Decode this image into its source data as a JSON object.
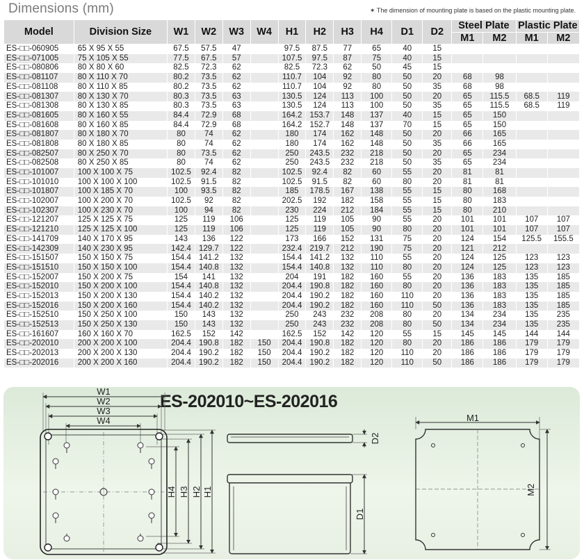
{
  "page": {
    "title": "Dimensions (mm)",
    "note": "✶ The dimension of mounting plate is based on the plastic mounting plate."
  },
  "table": {
    "headers": {
      "model": "Model",
      "division_size": "Division Size",
      "w1": "W1",
      "w2": "W2",
      "w3": "W3",
      "w4": "W4",
      "h1": "H1",
      "h2": "H2",
      "h3": "H3",
      "h4": "H4",
      "d1": "D1",
      "d2": "D2",
      "steel_plate": "Steel Plate",
      "plastic_plate": "Plastic Plate",
      "steel_m1": "M1",
      "steel_m2": "M2",
      "plastic_m1": "M1",
      "plastic_m2": "M2"
    },
    "rows": [
      [
        "ES-□□-060905",
        "65 X 95 X 55",
        "67.5",
        "57.5",
        "47",
        "",
        "97.5",
        "87.5",
        "77",
        "65",
        "40",
        "15",
        "",
        "",
        "",
        ""
      ],
      [
        "ES-□□-071005",
        "75 X 105 X 55",
        "77.5",
        "67.5",
        "57",
        "",
        "107.5",
        "97.5",
        "87",
        "75",
        "40",
        "15",
        "",
        "",
        "",
        ""
      ],
      [
        "ES-□□-080806",
        "80 X 80 X 60",
        "82.5",
        "72.3",
        "62",
        "",
        "82.5",
        "72.3",
        "62",
        "50",
        "45",
        "15",
        "",
        "",
        "",
        ""
      ],
      [
        "ES-□□-081107",
        "80 X 110 X 70",
        "80.2",
        "73.5",
        "62",
        "",
        "110.7",
        "104",
        "92",
        "80",
        "50",
        "20",
        "68",
        "98",
        "",
        ""
      ],
      [
        "ES-□□-081108",
        "80 X 110 X 85",
        "80.2",
        "73.5",
        "62",
        "",
        "110.7",
        "104",
        "92",
        "80",
        "50",
        "35",
        "68",
        "98",
        "",
        ""
      ],
      [
        "ES-□□-081307",
        "80 X 130 X 70",
        "80.3",
        "73.5",
        "63",
        "",
        "130.5",
        "124",
        "113",
        "100",
        "50",
        "20",
        "65",
        "115.5",
        "68.5",
        "119"
      ],
      [
        "ES-□□-081308",
        "80 X 130 X 85",
        "80.3",
        "73.5",
        "63",
        "",
        "130.5",
        "124",
        "113",
        "100",
        "50",
        "35",
        "65",
        "115.5",
        "68.5",
        "119"
      ],
      [
        "ES-□□-081605",
        "80 X 160 X 55",
        "84.4",
        "72.9",
        "68",
        "",
        "164.2",
        "153.7",
        "148",
        "137",
        "40",
        "15",
        "65",
        "150",
        "",
        ""
      ],
      [
        "ES-□□-081608",
        "80 X 160 X 85",
        "84.4",
        "72.9",
        "68",
        "",
        "164.2",
        "152.7",
        "148",
        "137",
        "70",
        "15",
        "65",
        "150",
        "",
        ""
      ],
      [
        "ES-□□-081807",
        "80 X 180 X 70",
        "80",
        "74",
        "62",
        "",
        "180",
        "174",
        "162",
        "148",
        "50",
        "20",
        "66",
        "165",
        "",
        ""
      ],
      [
        "ES-□□-081808",
        "80 X 180 X 85",
        "80",
        "74",
        "62",
        "",
        "180",
        "174",
        "162",
        "148",
        "50",
        "35",
        "66",
        "165",
        "",
        ""
      ],
      [
        "ES-□□-082507",
        "80 X 250 X 70",
        "80",
        "73.5",
        "62",
        "",
        "250",
        "243.5",
        "232",
        "218",
        "50",
        "20",
        "65",
        "234",
        "",
        ""
      ],
      [
        "ES-□□-082508",
        "80 X 250 X 85",
        "80",
        "74",
        "62",
        "",
        "250",
        "243.5",
        "232",
        "218",
        "50",
        "35",
        "65",
        "234",
        "",
        ""
      ],
      [
        "ES-□□-101007",
        "100 X 100 X 75",
        "102.5",
        "92.4",
        "82",
        "",
        "102.5",
        "92.4",
        "82",
        "60",
        "55",
        "20",
        "81",
        "81",
        "",
        ""
      ],
      [
        "ES-□□-101010",
        "100 X 100 X 100",
        "102.5",
        "91.5",
        "82",
        "",
        "102.5",
        "91.5",
        "82",
        "60",
        "80",
        "20",
        "81",
        "81",
        "",
        ""
      ],
      [
        "ES-□□-101807",
        "100 X 185 X 70",
        "100",
        "93.5",
        "82",
        "",
        "185",
        "178.5",
        "167",
        "138",
        "55",
        "15",
        "80",
        "168",
        "",
        ""
      ],
      [
        "ES-□□-102007",
        "100 X 200 X 70",
        "102.5",
        "92",
        "82",
        "",
        "202.5",
        "192",
        "182",
        "158",
        "55",
        "15",
        "80",
        "183",
        "",
        ""
      ],
      [
        "ES-□□-102307",
        "100 X 230 X 70",
        "100",
        "94",
        "82",
        "",
        "230",
        "224",
        "212",
        "184",
        "55",
        "15",
        "80",
        "210",
        "",
        ""
      ],
      [
        "ES-□□-121207",
        "125 X 125 X 75",
        "125",
        "119",
        "106",
        "",
        "125",
        "119",
        "105",
        "90",
        "55",
        "20",
        "101",
        "101",
        "107",
        "107"
      ],
      [
        "ES-□□-121210",
        "125 X 125 X 100",
        "125",
        "119",
        "106",
        "",
        "125",
        "119",
        "105",
        "90",
        "80",
        "20",
        "101",
        "101",
        "107",
        "107"
      ],
      [
        "ES-□□-141709",
        "140 X 170 X 95",
        "143",
        "136",
        "122",
        "",
        "173",
        "166",
        "152",
        "131",
        "75",
        "20",
        "124",
        "154",
        "125.5",
        "155.5"
      ],
      [
        "ES-□□-142309",
        "140 X 230 X 95",
        "142.4",
        "129.7",
        "122",
        "",
        "232.4",
        "219.7",
        "212",
        "190",
        "75",
        "20",
        "121",
        "212",
        "",
        ""
      ],
      [
        "ES-□□-151507",
        "150 X 150 X 75",
        "154.4",
        "141.2",
        "132",
        "",
        "154.4",
        "141.2",
        "132",
        "110",
        "55",
        "20",
        "124",
        "125",
        "123",
        "123"
      ],
      [
        "ES-□□-151510",
        "150 X 150 X 100",
        "154.4",
        "140.8",
        "132",
        "",
        "154.4",
        "140.8",
        "132",
        "110",
        "80",
        "20",
        "124",
        "125",
        "123",
        "123"
      ],
      [
        "ES-□□-152007",
        "150 X 200 X 75",
        "154",
        "141",
        "132",
        "",
        "204",
        "191",
        "182",
        "160",
        "55",
        "20",
        "136",
        "183",
        "135",
        "185"
      ],
      [
        "ES-□□-152010",
        "150 X 200 X 100",
        "154.4",
        "140.8",
        "132",
        "",
        "204.4",
        "190.8",
        "182",
        "160",
        "80",
        "20",
        "136",
        "183",
        "135",
        "185"
      ],
      [
        "ES-□□-152013",
        "150 X 200 X 130",
        "154.4",
        "140.2",
        "132",
        "",
        "204.4",
        "190.2",
        "182",
        "160",
        "110",
        "20",
        "136",
        "183",
        "135",
        "185"
      ],
      [
        "ES-□□-152016",
        "150 X 200 X 160",
        "154.4",
        "140.2",
        "132",
        "",
        "204.4",
        "190.2",
        "182",
        "160",
        "110",
        "50",
        "136",
        "183",
        "135",
        "185"
      ],
      [
        "ES-□□-152510",
        "150 X 250 X 100",
        "150",
        "143",
        "132",
        "",
        "250",
        "243",
        "232",
        "208",
        "80",
        "20",
        "134",
        "234",
        "135",
        "235"
      ],
      [
        "ES-□□-152513",
        "150 X 250 X 130",
        "150",
        "143",
        "132",
        "",
        "250",
        "243",
        "232",
        "208",
        "80",
        "50",
        "134",
        "234",
        "135",
        "235"
      ],
      [
        "ES-□□-161607",
        "160 X 160 X 70",
        "162.5",
        "152",
        "142",
        "",
        "162.5",
        "152",
        "142",
        "120",
        "55",
        "15",
        "145",
        "145",
        "144",
        "144"
      ],
      [
        "ES-□□-202010",
        "200 X 200 X 100",
        "204.4",
        "190.8",
        "182",
        "150",
        "204.4",
        "190.8",
        "182",
        "120",
        "80",
        "20",
        "186",
        "186",
        "179",
        "179"
      ],
      [
        "ES-□□-202013",
        "200 X 200 X 130",
        "204.4",
        "190.2",
        "182",
        "150",
        "204.4",
        "190.2",
        "182",
        "120",
        "110",
        "20",
        "186",
        "186",
        "179",
        "179"
      ],
      [
        "ES-□□-202016",
        "200 X 200 X 160",
        "204.4",
        "190.2",
        "182",
        "150",
        "204.4",
        "190.2",
        "182",
        "120",
        "110",
        "50",
        "186",
        "186",
        "179",
        "179"
      ]
    ]
  },
  "diagram": {
    "range_title": "ES-202010~ES-202016",
    "labels": {
      "w1": "W1",
      "w2": "W2",
      "w3": "W3",
      "w4": "W4",
      "h1": "H1",
      "h2": "H2",
      "h3": "H3",
      "h4": "H4",
      "d1": "D1",
      "d2": "D2",
      "m1": "M1",
      "m2": "M2"
    }
  }
}
